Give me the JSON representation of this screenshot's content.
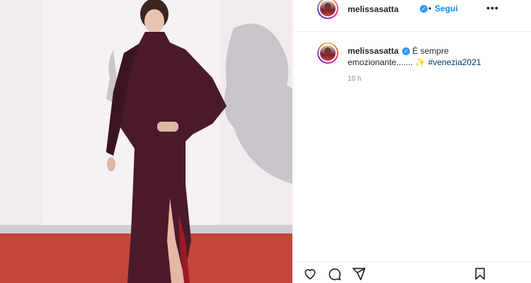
{
  "post": {
    "username": "melissasatta",
    "follow_label": "Segui",
    "dot": "•",
    "more_label": "•••",
    "verified_glyph": "✓",
    "caption_text": "È sempre emozionante.......",
    "caption_emoji": "✨",
    "hashtag": "#venezia2021",
    "time": "10 h"
  },
  "colors": {
    "follow_blue": "#0095f6",
    "verified_blue": "#3897f0",
    "hashtag": "#00376b"
  },
  "icons": {
    "like": "heart-icon",
    "comment": "comment-icon",
    "share": "send-icon",
    "save": "bookmark-icon"
  }
}
